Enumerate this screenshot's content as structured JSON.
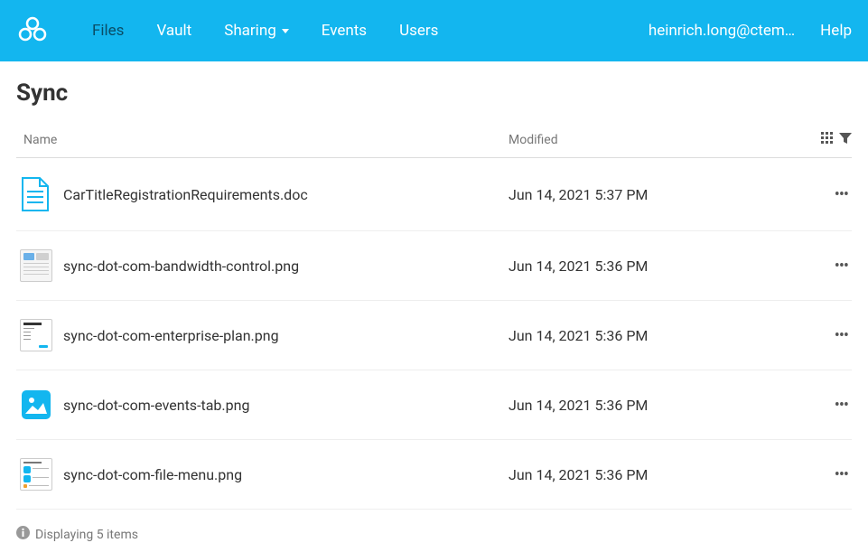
{
  "nav": {
    "items": [
      {
        "label": "Files",
        "active": true
      },
      {
        "label": "Vault",
        "active": false
      },
      {
        "label": "Sharing",
        "active": false,
        "dropdown": true
      },
      {
        "label": "Events",
        "active": false
      },
      {
        "label": "Users",
        "active": false
      }
    ],
    "user_email": "heinrich.long@ctem…",
    "help_label": "Help"
  },
  "page": {
    "title": "Sync"
  },
  "columns": {
    "name": "Name",
    "modified": "Modified"
  },
  "files": [
    {
      "name": "CarTitleRegistrationRequirements.doc",
      "modified": "Jun 14, 2021 5:37 PM",
      "type": "doc"
    },
    {
      "name": "sync-dot-com-bandwidth-control.png",
      "modified": "Jun 14, 2021 5:36 PM",
      "type": "thumb-bandwidth"
    },
    {
      "name": "sync-dot-com-enterprise-plan.png",
      "modified": "Jun 14, 2021 5:36 PM",
      "type": "thumb-enterprise"
    },
    {
      "name": "sync-dot-com-events-tab.png",
      "modified": "Jun 14, 2021 5:36 PM",
      "type": "image-icon"
    },
    {
      "name": "sync-dot-com-file-menu.png",
      "modified": "Jun 14, 2021 5:36 PM",
      "type": "thumb-filemenu"
    }
  ],
  "footer": {
    "text": "Displaying 5 items"
  }
}
